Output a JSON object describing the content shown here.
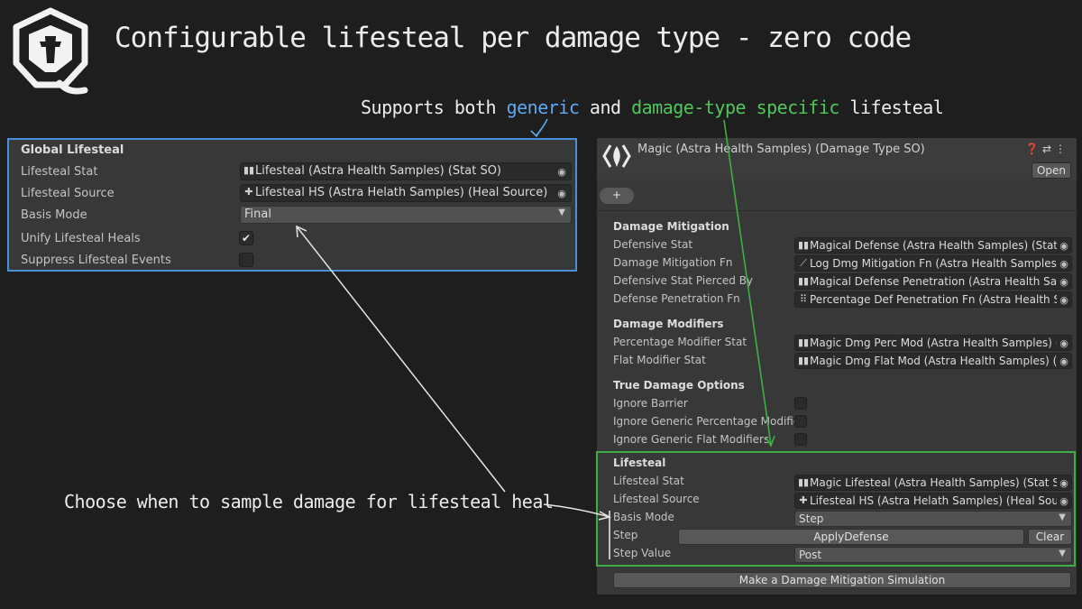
{
  "headline": "Configurable lifesteal per damage type - zero code",
  "subhead": {
    "prefix": "Supports both ",
    "generic": "generic",
    "mid": " and ",
    "specific": "damage-type specific",
    "suffix": " lifesteal"
  },
  "choose_note": "Choose when to sample damage for lifesteal heal",
  "colors": {
    "generic": "#5fa8f2",
    "specific": "#4fc75a",
    "panel_bg": "#383838",
    "page_bg": "#1e1e1e"
  },
  "global": {
    "header": "Global Lifesteal",
    "stat_label": "Lifesteal Stat",
    "stat_value": "Lifesteal (Astra Health Samples) (Stat SO)",
    "source_label": "Lifesteal Source",
    "source_value": "Lifesteal HS (Astra Helath Samples) (Heal Source)",
    "basis_label": "Basis Mode",
    "basis_value": "Final",
    "unify_label": "Unify Lifesteal Heals",
    "unify_checked": true,
    "suppress_label": "Suppress Lifesteal Events",
    "suppress_checked": false
  },
  "so": {
    "title": "Magic (Astra Health Samples) (Damage Type SO)",
    "tools": [
      "help-icon",
      "settings-sliders-icon",
      "kebab-menu-icon"
    ],
    "open_label": "Open",
    "add_label": "+",
    "mitigation": {
      "header": "Damage Mitigation",
      "defensive_stat_label": "Defensive Stat",
      "defensive_stat_value": "Magical Defense (Astra Health Samples) (Stat SO)",
      "mitigation_fn_label": "Damage Mitigation Fn",
      "mitigation_fn_value": "Log Dmg Mitigation Fn (Astra Health Samples) (L",
      "pierced_label": "Defensive Stat Pierced By",
      "pierced_value": "Magical Defense Penetration (Astra Health Samp",
      "penetration_label": "Defense Penetration Fn",
      "penetration_value": "Percentage Def Penetration Fn (Astra Health Sar"
    },
    "modifiers": {
      "header": "Damage Modifiers",
      "perc_label": "Percentage Modifier Stat",
      "perc_value": "Magic Dmg Perc Mod (Astra Health Samples) (St",
      "flat_label": "Flat Modifier Stat",
      "flat_value": "Magic Dmg Flat Mod (Astra Health Samples) (Sta"
    },
    "true_damage": {
      "header": "True Damage Options",
      "barrier_label": "Ignore Barrier",
      "generic_perc_label": "Ignore Generic Percentage Modifier",
      "generic_flat_label": "Ignore Generic Flat Modifiers"
    },
    "lifesteal": {
      "header": "Lifesteal",
      "stat_label": "Lifesteal Stat",
      "stat_value": "Magic Lifesteal (Astra Health Samples) (Stat SO)",
      "source_label": "Lifesteal Source",
      "source_value": "Lifesteal HS (Astra Helath Samples) (Heal Source)",
      "basis_label": "Basis Mode",
      "basis_value": "Step",
      "step_label": "Step",
      "step_value": "ApplyDefense",
      "clear_label": "Clear",
      "step_value_label": "Step Value",
      "step_value_value": "Post"
    },
    "simulate_label": "Make a Damage Mitigation Simulation"
  }
}
